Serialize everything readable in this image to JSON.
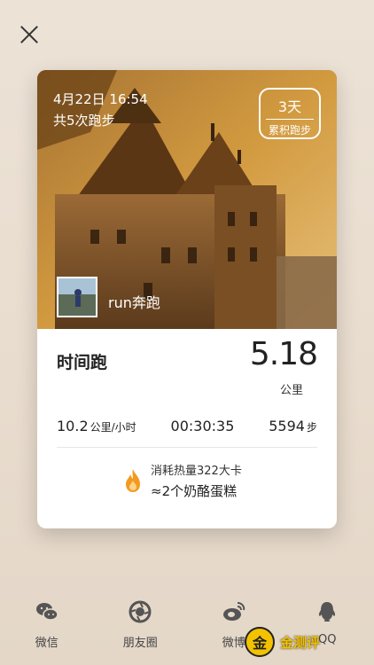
{
  "hero": {
    "date": "4月22日 16:54",
    "run_count": "共5次跑步",
    "badge_days": "3天",
    "badge_label": "累积跑步",
    "user_name": "run奔跑"
  },
  "stats": {
    "mode": "时间跑",
    "distance_value": "5.18",
    "distance_unit": "公里",
    "pace_value": "10.2",
    "pace_unit": "公里/小时",
    "duration": "00:30:35",
    "steps_value": "5594",
    "steps_unit": "步",
    "calorie_line1": "消耗热量322大卡",
    "calorie_line2": "≈2个奶酪蛋糕"
  },
  "share": [
    {
      "label": "微信",
      "icon": "wechat-icon"
    },
    {
      "label": "朋友圈",
      "icon": "moments-icon"
    },
    {
      "label": "微博",
      "icon": "weibo-icon"
    },
    {
      "label": "QQ",
      "icon": "qq-icon"
    }
  ],
  "watermark": {
    "glyph": "金",
    "text": "金测评"
  },
  "colors": {
    "accent_flame": "#f39a1e",
    "watermark": "#f2c200"
  }
}
